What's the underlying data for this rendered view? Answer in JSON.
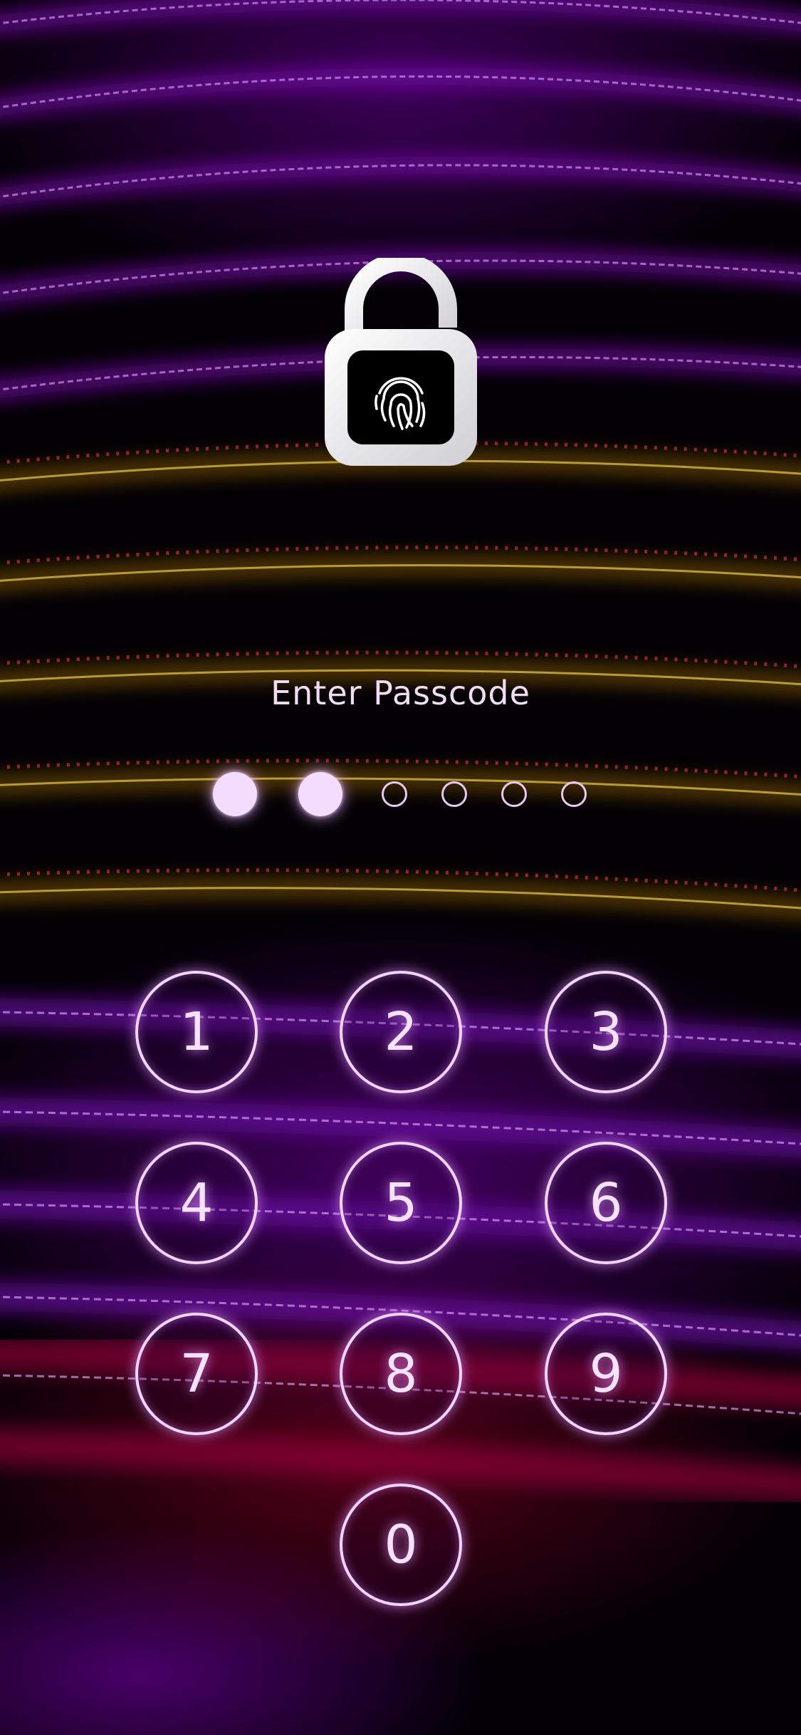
{
  "prompt": "Enter Passcode",
  "passcode": {
    "length": 6,
    "entered": 2
  },
  "keypad": [
    "1",
    "2",
    "3",
    "4",
    "5",
    "6",
    "7",
    "8",
    "9",
    "0"
  ],
  "icons": {
    "lock": "unlocked-padlock-icon",
    "fingerprint": "fingerprint-icon"
  },
  "colors": {
    "accent": "#f3d6ff",
    "glow": "#c86cff",
    "text": "#f0dcf3"
  }
}
